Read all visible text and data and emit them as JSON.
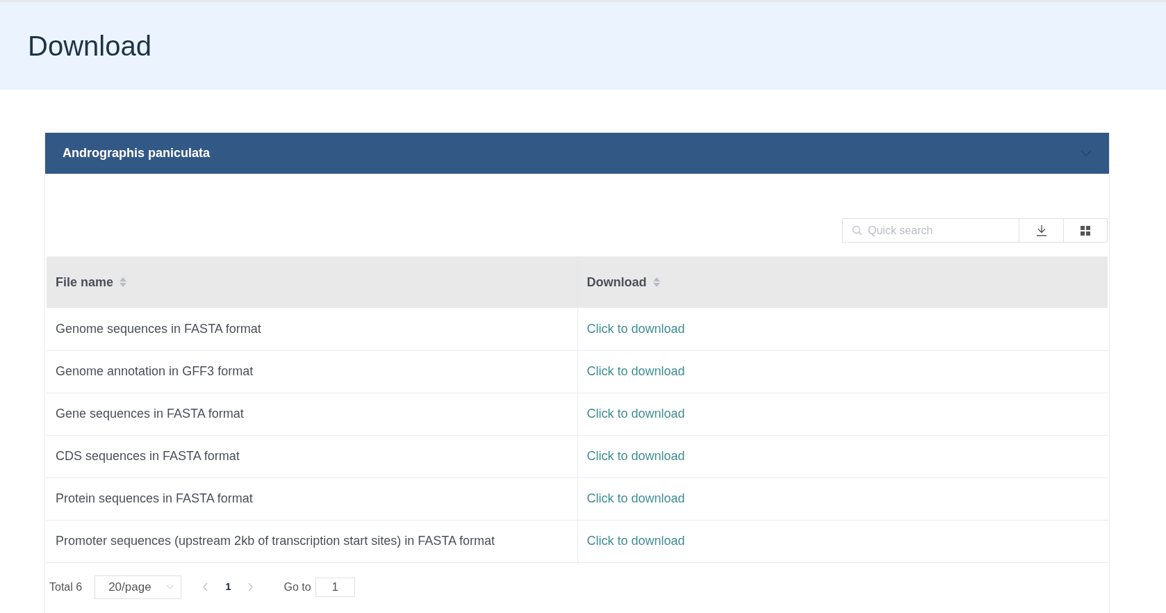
{
  "page": {
    "title": "Download"
  },
  "panel": {
    "title": "Andrographis paniculata",
    "expanded": true
  },
  "toolbar": {
    "search": {
      "placeholder": "Quick search"
    }
  },
  "table": {
    "columns": [
      "File name",
      "Download"
    ],
    "rows": [
      {
        "file_name": "Genome sequences in FASTA format",
        "download": "Click to download"
      },
      {
        "file_name": "Genome annotation in GFF3 format",
        "download": "Click to download"
      },
      {
        "file_name": "Gene sequences in FASTA format",
        "download": "Click to download"
      },
      {
        "file_name": "CDS sequences in FASTA format",
        "download": "Click to download"
      },
      {
        "file_name": "Protein sequences in FASTA format",
        "download": "Click to download"
      },
      {
        "file_name": "Promoter sequences (upstream 2kb of transcription start sites) in FASTA format",
        "download": "Click to download"
      }
    ]
  },
  "pagination": {
    "total": "Total 6",
    "page_size": "20/page",
    "pages": [
      {
        "label": "1",
        "selected": true
      }
    ],
    "goto_label": "Go to",
    "goto_value": "1"
  }
}
